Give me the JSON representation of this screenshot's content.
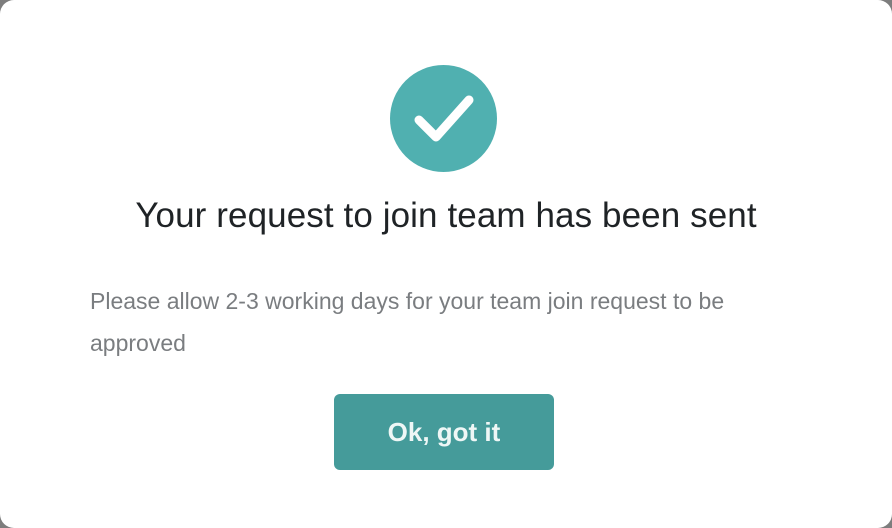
{
  "dialog": {
    "icon": "checkmark-circle-icon",
    "accent_color": "#50b0b0",
    "button_color": "#459b9a",
    "title": "Your request to join team has been sent",
    "message": "Please allow 2-3 working days for your team join request to be approved",
    "confirm_label": "Ok, got it"
  }
}
